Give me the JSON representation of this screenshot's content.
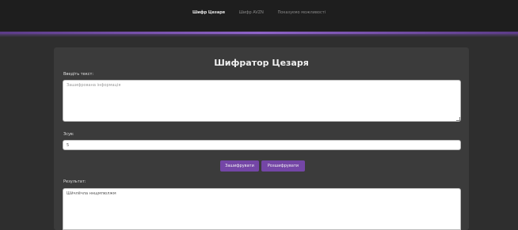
{
  "nav": {
    "items": [
      {
        "label": "Шифр Цезаря",
        "active": true
      },
      {
        "label": "Шифр AVZN",
        "active": false
      },
      {
        "label": "Показуємо можливості",
        "active": false
      }
    ]
  },
  "form": {
    "title": "Шифратор Цезаря",
    "input_label": "Введіть текст:",
    "input_placeholder": "Зашифрована інформація",
    "shift_label": "Зсув:",
    "shift_value": "5",
    "encrypt_label": "Зашифрувати",
    "decrypt_label": "Розшифрувати",
    "result_label": "Результат:",
    "result_value": "Шйчлёчла ннщмпюлжм"
  },
  "colors": {
    "accent": "#7446a6",
    "background": "#2e2e2e",
    "card": "#3b3b3b",
    "topbar": "#1e1e1e"
  }
}
